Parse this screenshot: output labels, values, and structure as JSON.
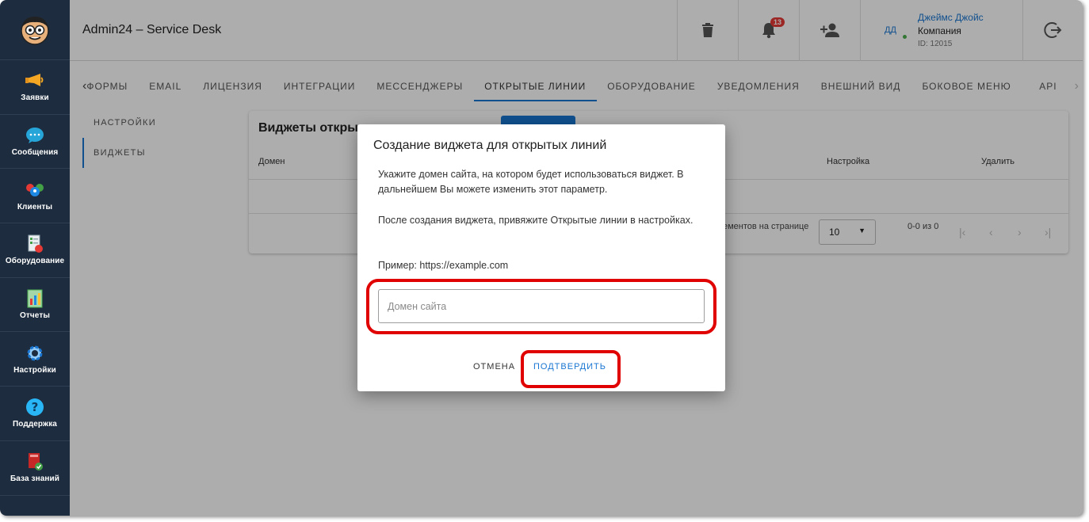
{
  "app": {
    "title": "Admin24 – Service Desk"
  },
  "sidebar": {
    "items": [
      {
        "label": "Заявки",
        "icon": "megaphone-icon"
      },
      {
        "label": "Сообщения",
        "icon": "chat-bubble-icon"
      },
      {
        "label": "Клиенты",
        "icon": "people-icon"
      },
      {
        "label": "Оборудование",
        "icon": "equipment-icon"
      },
      {
        "label": "Отчеты",
        "icon": "report-icon"
      },
      {
        "label": "Настройки",
        "icon": "gear-icon"
      },
      {
        "label": "Поддержка",
        "icon": "help-icon"
      },
      {
        "label": "База знаний",
        "icon": "book-icon"
      }
    ]
  },
  "header": {
    "notifications_count": "13",
    "user": {
      "initials": "ДД",
      "name": "Джеймс Джойс",
      "company": "Компания",
      "id": "ID: 12015"
    }
  },
  "tabs": [
    {
      "label": "ФОРМЫ",
      "active": false
    },
    {
      "label": "EMAIL",
      "active": false
    },
    {
      "label": "ЛИЦЕНЗИЯ",
      "active": false
    },
    {
      "label": "ИНТЕГРАЦИИ",
      "active": false
    },
    {
      "label": "МЕССЕНДЖЕРЫ",
      "active": false
    },
    {
      "label": "ОТКРЫТЫЕ ЛИНИИ",
      "active": true
    },
    {
      "label": "ОБОРУДОВАНИЕ",
      "active": false
    },
    {
      "label": "УВЕДОМЛЕНИЯ",
      "active": false
    },
    {
      "label": "ВНЕШНИЙ ВИД",
      "active": false
    },
    {
      "label": "БОКОВОЕ МЕНЮ",
      "active": false
    },
    {
      "label": "API",
      "active": false
    }
  ],
  "submenu": [
    {
      "label": "НАСТРОЙКИ",
      "active": false
    },
    {
      "label": "ВИДЖЕТЫ",
      "active": true
    }
  ],
  "card": {
    "title": "Виджеты откры",
    "columns": {
      "domain": "Домен",
      "settings": "Настройка",
      "delete": "Удалить"
    },
    "pager": {
      "per_page_label": "ементов на странице",
      "per_page_value": "10",
      "range": "0-0 из 0"
    }
  },
  "dialog": {
    "title": "Создание виджета для открытых линий",
    "text1": "Укажите домен сайта, на котором будет использоваться виджет. В дальнейшем Вы можете изменить этот параметр.",
    "text2": "После создания виджета, привяжите Открытые линии в настройках.",
    "example": "Пример: https://example.com",
    "input_placeholder": "Домен сайта",
    "input_value": "",
    "cancel_label": "ОТМЕНА",
    "confirm_label": "ПОДТВЕРДИТЬ"
  },
  "colors": {
    "sidebar_bg": "#1d2c3e",
    "accent": "#1976d2",
    "highlight": "#e00000",
    "badge": "#e53935"
  }
}
